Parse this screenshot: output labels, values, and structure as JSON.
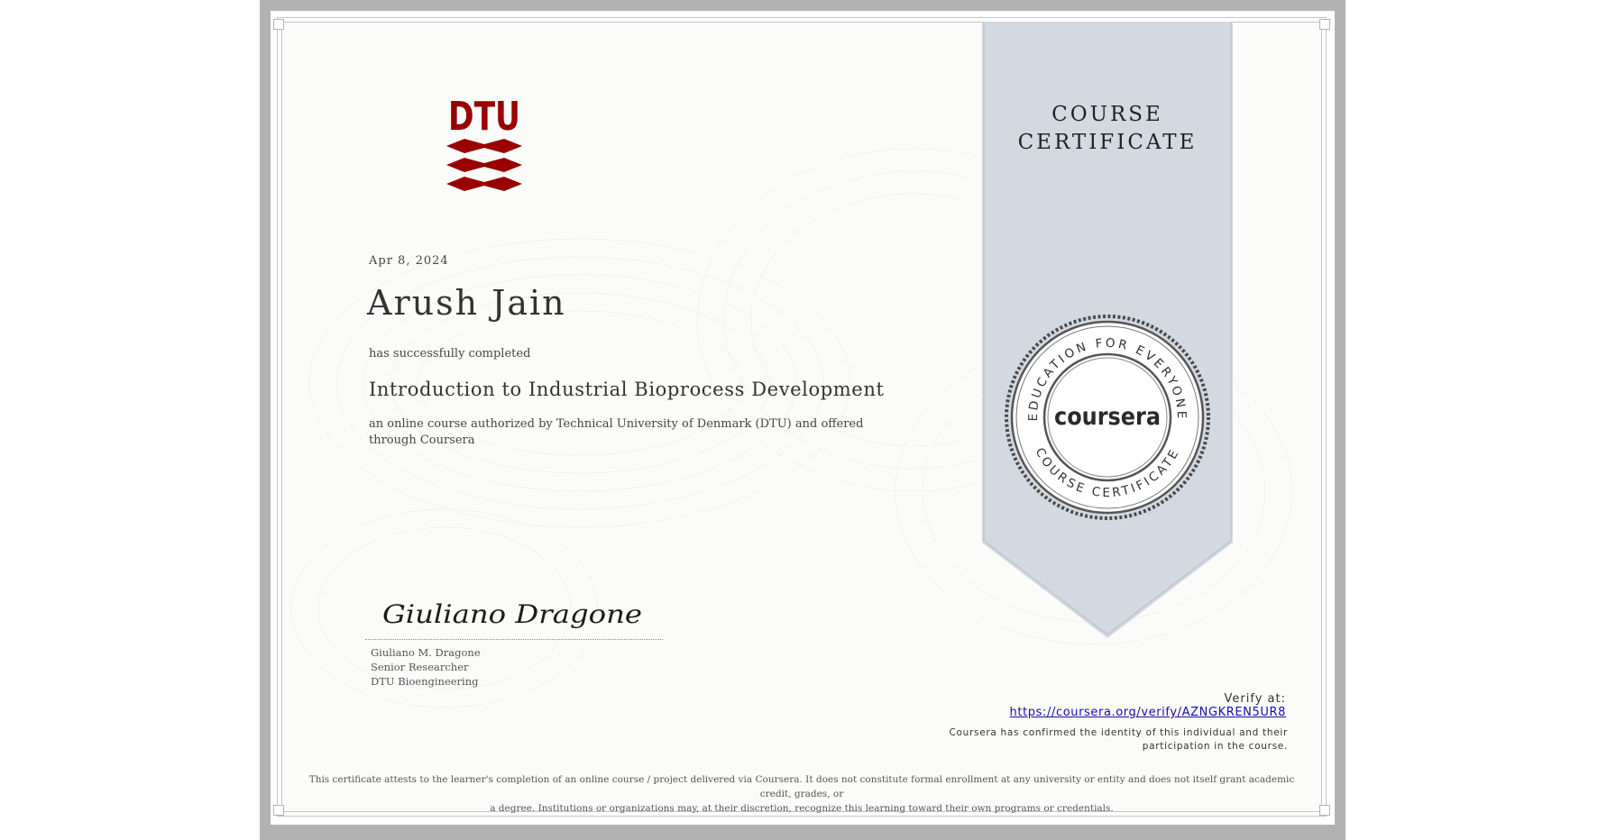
{
  "institution": {
    "logo_text": "DTU"
  },
  "date": "Apr 8, 2024",
  "recipient": "Arush Jain",
  "completed_text": "has successfully completed",
  "course_title": "Introduction to Industrial Bioprocess Development",
  "description": "an online course authorized by Technical University of Denmark (DTU) and offered through Coursera",
  "signature": {
    "image_text": "Giuliano Dragone",
    "name": "Giuliano M. Dragone",
    "title": "Senior Researcher",
    "department": "DTU Bioengineering"
  },
  "ribbon": {
    "line1": "COURSE",
    "line2": "CERTIFICATE"
  },
  "seal": {
    "brand": "coursera",
    "top_arc": "EDUCATION FOR EVERYONE",
    "bottom_arc": "COURSE CERTIFICATE"
  },
  "verify": {
    "label": "Verify at:",
    "url": "https://coursera.org/verify/AZNGKREN5UR8"
  },
  "confirmation": {
    "line1": "Coursera has confirmed the identity of this individual and their",
    "line2": "participation in the course."
  },
  "disclaimer": {
    "line1": "This certificate attests to the learner's completion of an online course / project delivered via Coursera. It does not constitute formal enrollment at any university or entity and does not itself grant academic credit, grades, or",
    "line2": "a degree. Institutions or organizations may, at their discretion, recognize this learning toward their own programs or credentials."
  },
  "colors": {
    "brand_red": "#990000",
    "ribbon": "#d3d9e1",
    "frame": "#b2b2b2",
    "link": "#1a0dab"
  }
}
